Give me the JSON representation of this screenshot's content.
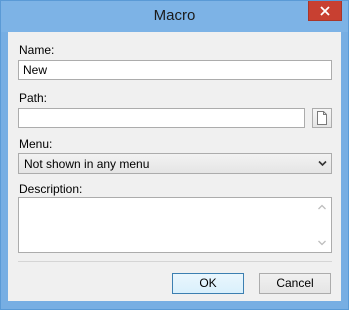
{
  "window": {
    "title": "Macro"
  },
  "form": {
    "name_label": "Name:",
    "name_value": "New",
    "path_label": "Path:",
    "path_value": "",
    "menu_label": "Menu:",
    "menu_selected": "Not shown in any menu",
    "description_label": "Description:",
    "description_value": ""
  },
  "buttons": {
    "ok": "OK",
    "cancel": "Cancel"
  },
  "icons": {
    "close": "close-icon",
    "browse": "document-icon",
    "dropdown": "chevron-down-icon",
    "scroll_up": "scroll-up-icon",
    "scroll_down": "scroll-down-icon"
  },
  "colors": {
    "title_bar": "#7db3e6",
    "close_button": "#c84031",
    "dialog_background": "#f0f0f0",
    "default_button_border": "#3c7fb1"
  }
}
